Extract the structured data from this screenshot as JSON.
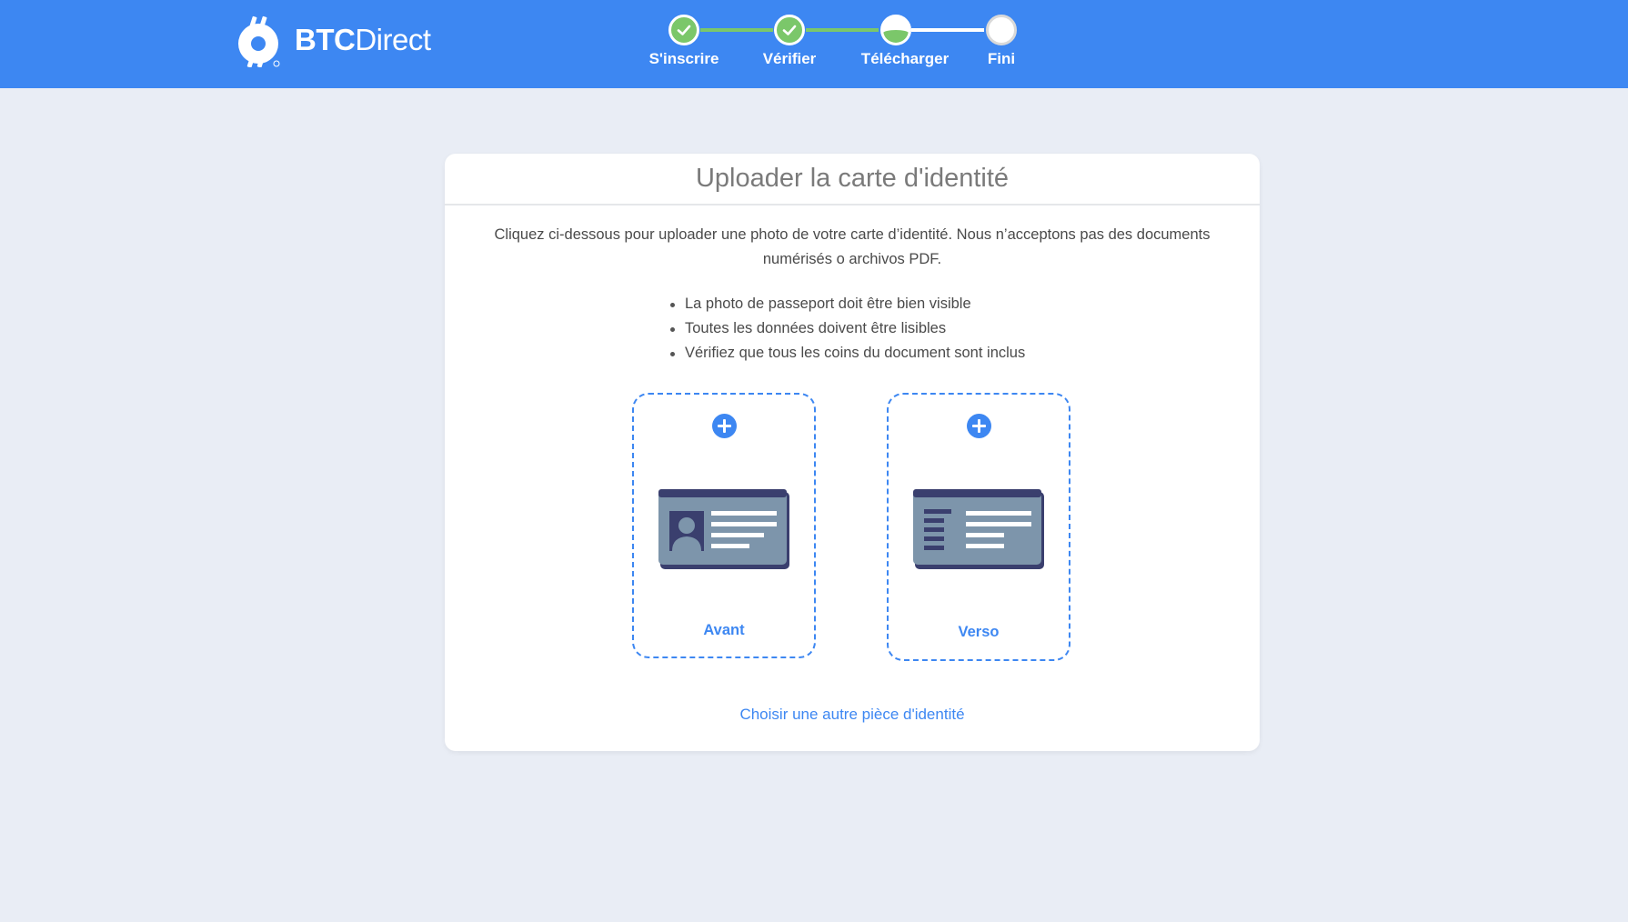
{
  "brand": {
    "bold": "BTC",
    "thin": "Direct"
  },
  "steps": [
    {
      "label": "S'inscrire",
      "state": "done"
    },
    {
      "label": "Vérifier",
      "state": "done"
    },
    {
      "label": "Télécharger",
      "state": "current"
    },
    {
      "label": "Fini",
      "state": "todo"
    }
  ],
  "card": {
    "title": "Uploader la carte d'identité",
    "intro": "Cliquez ci-dessous pour uploader une photo de votre carte d’identité. Nous n’acceptons pas des documents numérisés o archivos PDF.",
    "bullets": [
      "La photo de passeport doit être bien visible",
      "Toutes les données doivent être lisibles",
      "Vérifiez que tous les coins du document sont inclus"
    ],
    "front_label": "Avant",
    "back_label": "Verso",
    "alt_link": "Choisir une autre pièce d'identité"
  },
  "colors": {
    "header": "#3d87f2",
    "accent": "#3d87f2",
    "success": "#7bc76a",
    "background": "#e9edf5",
    "id_card": "#7d95ab",
    "id_card_dark": "#3a3f6e"
  },
  "icons": {
    "logo": "btc-direct-logo-icon",
    "step_done": "check-icon",
    "upload": "plus-circle-icon",
    "id_front": "id-card-front-icon",
    "id_back": "id-card-back-icon"
  }
}
